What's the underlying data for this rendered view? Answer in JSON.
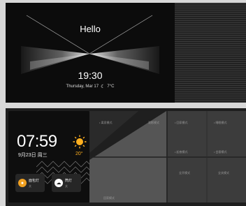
{
  "top_screen": {
    "greeting": "Hello",
    "time": "19:30",
    "date": "Thursday, Mar 17",
    "weather_icon": "moon-icon",
    "temperature": "7°C"
  },
  "bottom_screen": {
    "time": "07:59",
    "date": "9月23日 周三",
    "weather_icon": "sun-icon",
    "temperature": "20°",
    "device_chips": [
      {
        "name": "面包灯",
        "state": "关",
        "icon": "bulb-icon",
        "color": "#f0a020"
      },
      {
        "name": "筒灯",
        "state": "关",
        "icon": "cloud-icon",
        "color": "#ffffff"
      }
    ],
    "scene_labels": [
      "• 离家模式",
      "观影模式",
      "• 回家模式",
      "• 睡眠模式",
      "• 起夜模式",
      "• 会客模式",
      "全开模式",
      "全关模式",
      "回家模式"
    ]
  },
  "colors": {
    "accent": "#ffb020",
    "screen_bg": "#0c0c0c"
  }
}
